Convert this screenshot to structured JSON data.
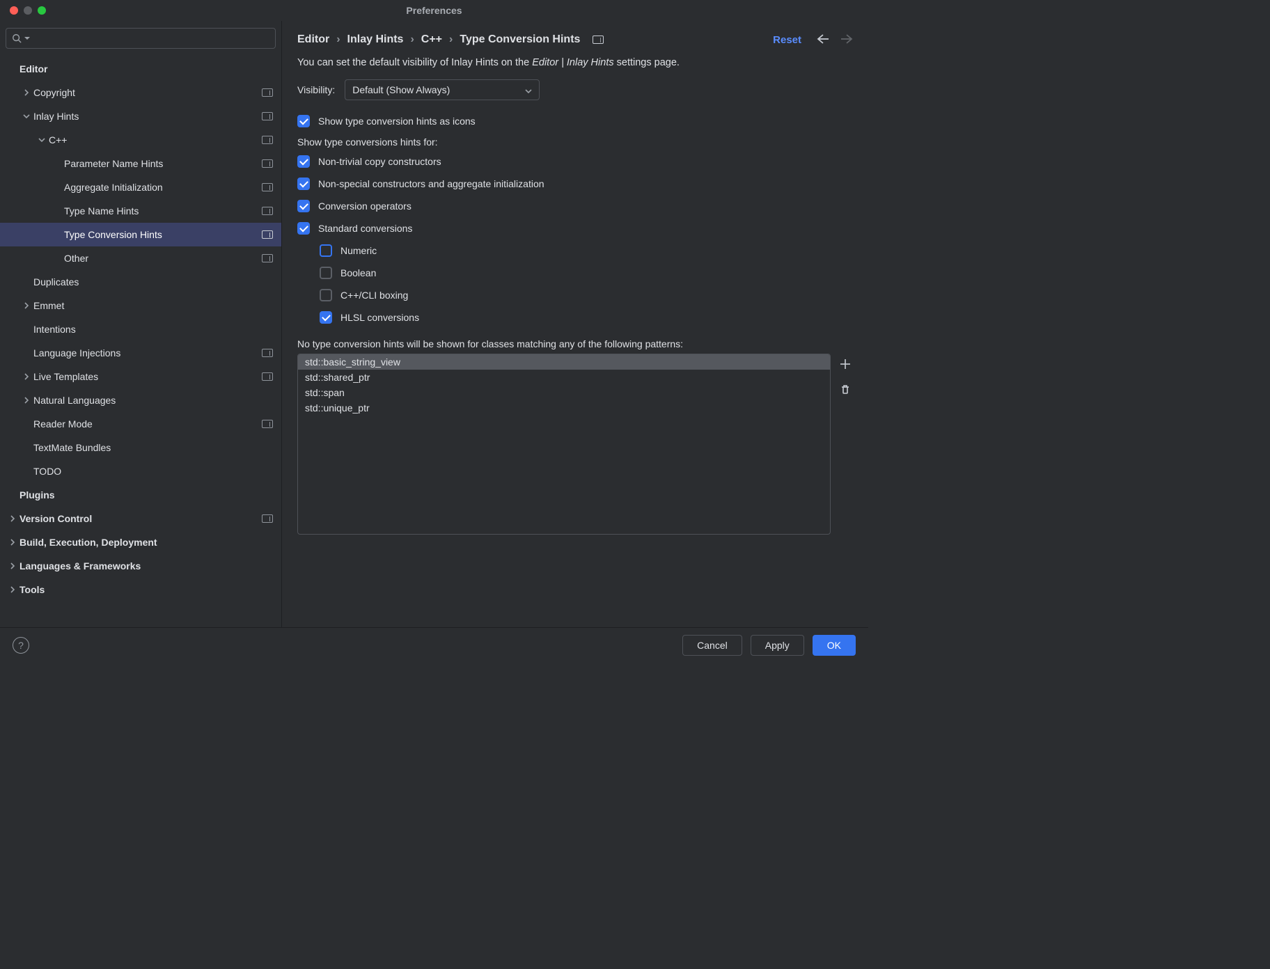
{
  "window": {
    "title": "Preferences"
  },
  "search": {
    "placeholder": ""
  },
  "sidebar": {
    "items": [
      {
        "label": "Editor",
        "indent": 0,
        "bold": true,
        "expander": "",
        "badge": false
      },
      {
        "label": "Copyright",
        "indent": 1,
        "bold": false,
        "expander": "right",
        "badge": true
      },
      {
        "label": "Inlay Hints",
        "indent": 1,
        "bold": false,
        "expander": "down",
        "badge": true
      },
      {
        "label": "C++",
        "indent": 2,
        "bold": false,
        "expander": "down",
        "badge": true
      },
      {
        "label": "Parameter Name Hints",
        "indent": 3,
        "bold": false,
        "expander": "",
        "badge": true
      },
      {
        "label": "Aggregate Initialization",
        "indent": 3,
        "bold": false,
        "expander": "",
        "badge": true
      },
      {
        "label": "Type Name Hints",
        "indent": 3,
        "bold": false,
        "expander": "",
        "badge": true
      },
      {
        "label": "Type Conversion Hints",
        "indent": 3,
        "bold": false,
        "expander": "",
        "badge": true,
        "selected": true
      },
      {
        "label": "Other",
        "indent": 3,
        "bold": false,
        "expander": "",
        "badge": true
      },
      {
        "label": "Duplicates",
        "indent": 1,
        "bold": false,
        "expander": "",
        "badge": false
      },
      {
        "label": "Emmet",
        "indent": 1,
        "bold": false,
        "expander": "right",
        "badge": false
      },
      {
        "label": "Intentions",
        "indent": 1,
        "bold": false,
        "expander": "",
        "badge": false
      },
      {
        "label": "Language Injections",
        "indent": 1,
        "bold": false,
        "expander": "",
        "badge": true
      },
      {
        "label": "Live Templates",
        "indent": 1,
        "bold": false,
        "expander": "right",
        "badge": true
      },
      {
        "label": "Natural Languages",
        "indent": 1,
        "bold": false,
        "expander": "right",
        "badge": false
      },
      {
        "label": "Reader Mode",
        "indent": 1,
        "bold": false,
        "expander": "",
        "badge": true
      },
      {
        "label": "TextMate Bundles",
        "indent": 1,
        "bold": false,
        "expander": "",
        "badge": false
      },
      {
        "label": "TODO",
        "indent": 1,
        "bold": false,
        "expander": "",
        "badge": false
      },
      {
        "label": "Plugins",
        "indent": 0,
        "bold": true,
        "expander": "",
        "badge": false
      },
      {
        "label": "Version Control",
        "indent": 0,
        "bold": true,
        "expander": "right",
        "badge": true
      },
      {
        "label": "Build, Execution, Deployment",
        "indent": 0,
        "bold": true,
        "expander": "right",
        "badge": false
      },
      {
        "label": "Languages & Frameworks",
        "indent": 0,
        "bold": true,
        "expander": "right",
        "badge": false
      },
      {
        "label": "Tools",
        "indent": 0,
        "bold": true,
        "expander": "right",
        "badge": false
      }
    ]
  },
  "breadcrumb": {
    "parts": [
      "Editor",
      "Inlay Hints",
      "C++",
      "Type Conversion Hints"
    ]
  },
  "reset_label": "Reset",
  "intro": {
    "prefix": "You can set the default visibility of Inlay Hints on the ",
    "em": "Editor | Inlay Hints",
    "suffix": " settings page."
  },
  "visibility": {
    "label": "Visibility:",
    "selected": "Default (Show Always)"
  },
  "opts": {
    "icons": "Show type conversion hints as icons",
    "for_label": "Show type conversions hints for:",
    "copy": "Non-trivial copy constructors",
    "nonspecial": "Non-special constructors and aggregate initialization",
    "convops": "Conversion operators",
    "std": "Standard conversions",
    "numeric": "Numeric",
    "boolean": "Boolean",
    "cli": "C++/CLI boxing",
    "hlsl": "HLSL conversions"
  },
  "patterns": {
    "note": "No type conversion hints will be shown for classes matching any of the following patterns:",
    "items": [
      "std::basic_string_view",
      "std::shared_ptr",
      "std::span",
      "std::unique_ptr"
    ]
  },
  "footer": {
    "cancel": "Cancel",
    "apply": "Apply",
    "ok": "OK"
  }
}
